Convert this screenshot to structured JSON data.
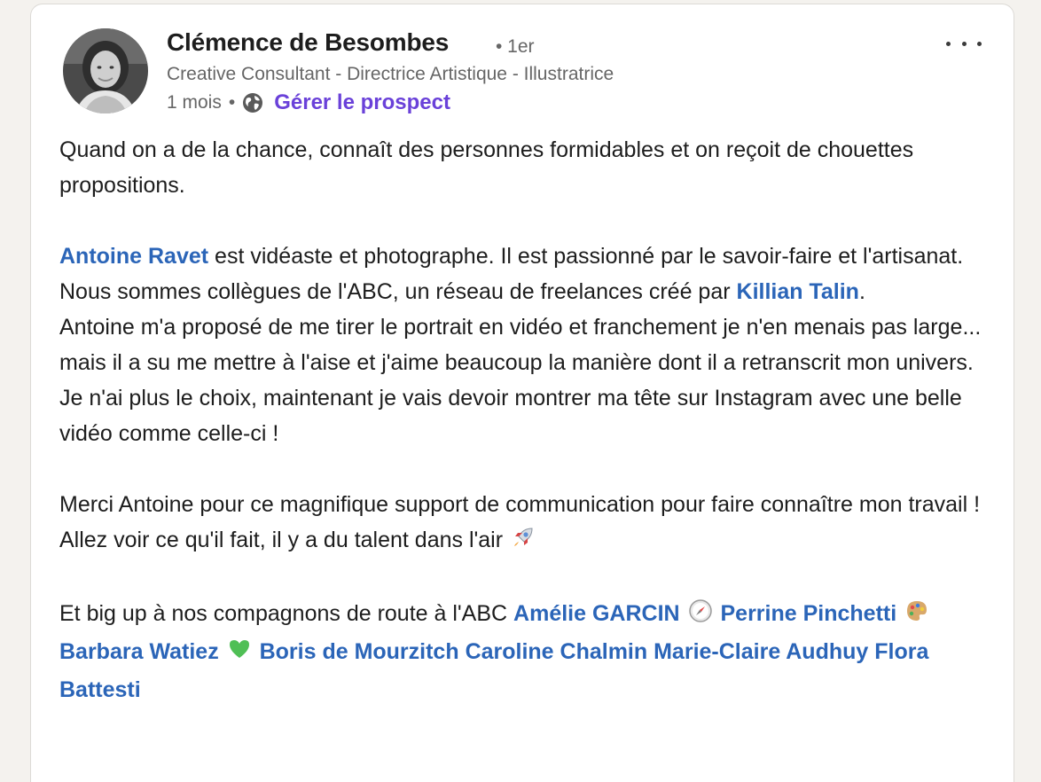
{
  "author": {
    "name": "Clémence de Besombes",
    "degree": "• 1er",
    "headline": "Creative Consultant - Directrice Artistique - Illustratrice",
    "time": "1 mois",
    "meta_sep": "•",
    "visibility_icon": "globe-icon",
    "manage_link": "Gérer le prospect"
  },
  "more_icon": "more-horizontal-icon",
  "post": {
    "p1": "Quand on a de la chance, connaît des personnes formidables et on reçoit de chouettes propositions.",
    "p2": {
      "mention1": "Antoine Ravet",
      "text1": " est vidéaste et photographe. Il est passionné par le savoir-faire et l'artisanat. Nous sommes collègues de l'ABC, un réseau de freelances créé par ",
      "mention2": "Killian Talin",
      "text2": "."
    },
    "p3": "Antoine m'a proposé de me tirer le portrait en vidéo et franchement je n'en menais pas large... mais il a su me mettre à l'aise et j'aime beaucoup la manière dont il a retranscrit mon univers.",
    "p4": "Je n'ai plus le choix, maintenant je vais devoir montrer ma tête sur Instagram avec une belle vidéo comme celle-ci !",
    "p5": "Merci Antoine pour ce magnifique support de communication pour faire connaître mon travail ! Allez voir ce qu'il fait, il y a du talent dans l'air",
    "p5_emoji": "rocket-icon",
    "p6": {
      "text": "Et big up à nos compagnons de route à l'ABC ",
      "mention_amelie": "Amélie GARCIN",
      "emoji_compass": "compass-icon",
      "mention_perrine": "Perrine Pinchetti",
      "emoji_palette": "palette-icon",
      "mention_barbara": "Barbara Watiez",
      "emoji_heart": "green-heart-icon",
      "mention_boris": "Boris de Mourzitch",
      "mention_caroline": "Caroline Chalmin",
      "mention_marie": "Marie-Claire Audhuy",
      "mention_flora": "Flora Battesti"
    }
  },
  "colors": {
    "mention": "#2b65b8",
    "manage_link": "#6a41d9",
    "secondary_text": "#666666"
  }
}
